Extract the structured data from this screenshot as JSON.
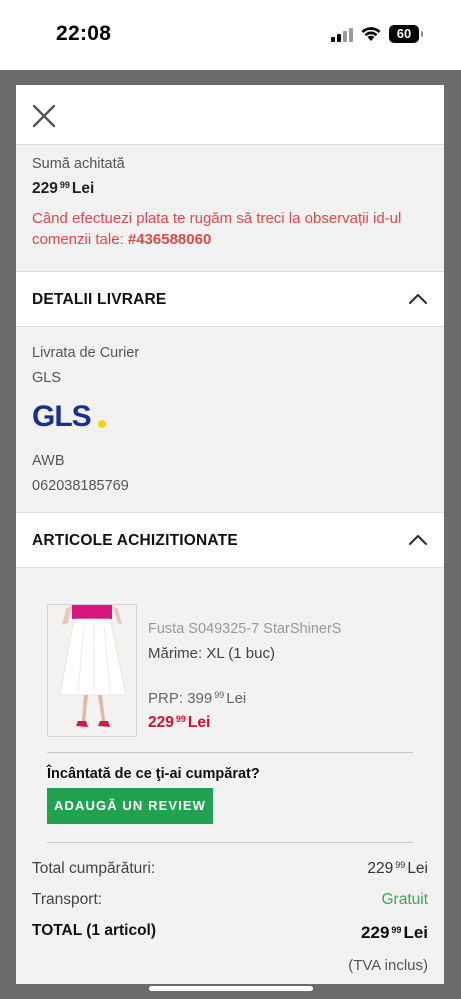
{
  "status_bar": {
    "time": "22:08",
    "battery": "60"
  },
  "payment": {
    "label": "Sumă achitată",
    "amount_int": "229",
    "amount_dec": "99",
    "currency": "Lei",
    "notice_text": "Când efectuezi plata te rugăm să treci la observații id-ul comenzii tale: ",
    "order_id": "#436588060"
  },
  "delivery": {
    "title": "DETALII LIVRARE",
    "method_label": "Livrata de Curier",
    "courier": "GLS",
    "logo_text": "GLS",
    "awb_label": "AWB",
    "awb": "062038185769"
  },
  "items": {
    "title": "ARTICOLE ACHIZITIONATE",
    "list": [
      {
        "name": "Fusta S049325-7 StarShinerS",
        "size": "Mărime: XL (1 buc)",
        "prp_label": "PRP:",
        "prp_int": "399",
        "prp_dec": "99",
        "prp_currency": "Lei",
        "price_int": "229",
        "price_dec": "99",
        "price_currency": "Lei"
      }
    ],
    "review_question": "Încântată de ce ţi-ai cumpărat?",
    "review_button": "ADAUGĂ UN REVIEW"
  },
  "totals": {
    "subtotal_label": "Total cumpărături:",
    "subtotal_int": "229",
    "subtotal_dec": "99",
    "subtotal_currency": "Lei",
    "shipping_label": "Transport:",
    "shipping_value": "Gratuit",
    "total_label": "TOTAL (1 articol)",
    "total_int": "229",
    "total_dec": "99",
    "total_currency": "Lei",
    "vat_note": "(TVA inclus)"
  },
  "colors": {
    "accent_red": "#e1474b",
    "price_red": "#d0112b",
    "green": "#21a24f",
    "gls_blue": "#1b2f8f",
    "gls_yellow": "#f5d20a"
  }
}
